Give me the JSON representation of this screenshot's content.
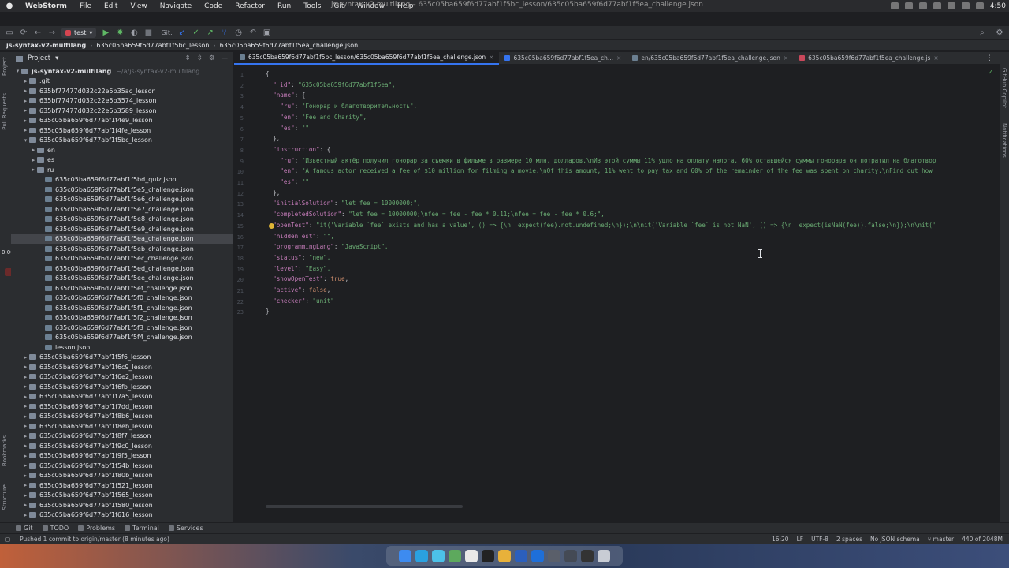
{
  "menubar": {
    "app": "WebStorm",
    "items": [
      "File",
      "Edit",
      "View",
      "Navigate",
      "Code",
      "Refactor",
      "Run",
      "Tools",
      "Git",
      "Window",
      "Help"
    ],
    "window_title": "js-syntax-v2-multilang – 635c05ba659f6d77abf1f5bc_lesson/635c05ba659f6d77abf1f5ea_challenge.json",
    "clock": "4:50"
  },
  "toolbar": {
    "run_config": "test",
    "git_label": "Git:"
  },
  "breadcrumb": [
    "js-syntax-v2-multilang",
    "635c05ba659f6d77abf1f5bc_lesson",
    "635c05ba659f6d77abf1f5ea_challenge.json"
  ],
  "left_strip": {
    "project": "Project",
    "pull_requests": "Pull Requests",
    "timer": "0:00",
    "bookmarks": "Bookmarks",
    "structure": "Structure"
  },
  "project_panel": {
    "title": "Project",
    "root": {
      "name": "js-syntax-v2-multilang",
      "path": "~/a/js-syntax-v2-multilang"
    },
    "items": [
      {
        "label": ".git",
        "indent": 1,
        "type": "folder",
        "arrow": "▸"
      },
      {
        "label": "635bf77477d032c22e5b35ac_lesson",
        "indent": 1,
        "type": "folder",
        "arrow": "▸"
      },
      {
        "label": "635bf77477d032c22e5b3574_lesson",
        "indent": 1,
        "type": "folder",
        "arrow": "▸"
      },
      {
        "label": "635bf77477d032c22e5b3589_lesson",
        "indent": 1,
        "type": "folder",
        "arrow": "▸"
      },
      {
        "label": "635c05ba659f6d77abf1f4e9_lesson",
        "indent": 1,
        "type": "folder",
        "arrow": "▸"
      },
      {
        "label": "635c05ba659f6d77abf1f4fe_lesson",
        "indent": 1,
        "type": "folder",
        "arrow": "▸"
      },
      {
        "label": "635c05ba659f6d77abf1f5bc_lesson",
        "indent": 1,
        "type": "folder",
        "arrow": "▾"
      },
      {
        "label": "en",
        "indent": 2,
        "type": "folder",
        "arrow": "▸"
      },
      {
        "label": "es",
        "indent": 2,
        "type": "folder",
        "arrow": "▸"
      },
      {
        "label": "ru",
        "indent": 2,
        "type": "folder",
        "arrow": "▸"
      },
      {
        "label": "635c05ba659f6d77abf1f5bd_quiz.json",
        "indent": 3,
        "type": "file",
        "arrow": ""
      },
      {
        "label": "635c05ba659f6d77abf1f5e5_challenge.json",
        "indent": 3,
        "type": "file",
        "arrow": ""
      },
      {
        "label": "635c05ba659f6d77abf1f5e6_challenge.json",
        "indent": 3,
        "type": "file",
        "arrow": ""
      },
      {
        "label": "635c05ba659f6d77abf1f5e7_challenge.json",
        "indent": 3,
        "type": "file",
        "arrow": ""
      },
      {
        "label": "635c05ba659f6d77abf1f5e8_challenge.json",
        "indent": 3,
        "type": "file",
        "arrow": ""
      },
      {
        "label": "635c05ba659f6d77abf1f5e9_challenge.json",
        "indent": 3,
        "type": "file",
        "arrow": ""
      },
      {
        "label": "635c05ba659f6d77abf1f5ea_challenge.json",
        "indent": 3,
        "type": "file",
        "arrow": "",
        "selected": true
      },
      {
        "label": "635c05ba659f6d77abf1f5eb_challenge.json",
        "indent": 3,
        "type": "file",
        "arrow": ""
      },
      {
        "label": "635c05ba659f6d77abf1f5ec_challenge.json",
        "indent": 3,
        "type": "file",
        "arrow": ""
      },
      {
        "label": "635c05ba659f6d77abf1f5ed_challenge.json",
        "indent": 3,
        "type": "file",
        "arrow": ""
      },
      {
        "label": "635c05ba659f6d77abf1f5ee_challenge.json",
        "indent": 3,
        "type": "file",
        "arrow": ""
      },
      {
        "label": "635c05ba659f6d77abf1f5ef_challenge.json",
        "indent": 3,
        "type": "file",
        "arrow": ""
      },
      {
        "label": "635c05ba659f6d77abf1f5f0_challenge.json",
        "indent": 3,
        "type": "file",
        "arrow": ""
      },
      {
        "label": "635c05ba659f6d77abf1f5f1_challenge.json",
        "indent": 3,
        "type": "file",
        "arrow": ""
      },
      {
        "label": "635c05ba659f6d77abf1f5f2_challenge.json",
        "indent": 3,
        "type": "file",
        "arrow": ""
      },
      {
        "label": "635c05ba659f6d77abf1f5f3_challenge.json",
        "indent": 3,
        "type": "file",
        "arrow": ""
      },
      {
        "label": "635c05ba659f6d77abf1f5f4_challenge.json",
        "indent": 3,
        "type": "file",
        "arrow": ""
      },
      {
        "label": "lesson.json",
        "indent": 3,
        "type": "file",
        "arrow": ""
      },
      {
        "label": "635c05ba659f6d77abf1f5f6_lesson",
        "indent": 1,
        "type": "folder",
        "arrow": "▸"
      },
      {
        "label": "635c05ba659f6d77abf1f6c9_lesson",
        "indent": 1,
        "type": "folder",
        "arrow": "▸"
      },
      {
        "label": "635c05ba659f6d77abf1f6e2_lesson",
        "indent": 1,
        "type": "folder",
        "arrow": "▸"
      },
      {
        "label": "635c05ba659f6d77abf1f6fb_lesson",
        "indent": 1,
        "type": "folder",
        "arrow": "▸"
      },
      {
        "label": "635c05ba659f6d77abf1f7a5_lesson",
        "indent": 1,
        "type": "folder",
        "arrow": "▸"
      },
      {
        "label": "635c05ba659f6d77abf1f7dd_lesson",
        "indent": 1,
        "type": "folder",
        "arrow": "▸"
      },
      {
        "label": "635c05ba659f6d77abf1f8b6_lesson",
        "indent": 1,
        "type": "folder",
        "arrow": "▸"
      },
      {
        "label": "635c05ba659f6d77abf1f8eb_lesson",
        "indent": 1,
        "type": "folder",
        "arrow": "▸"
      },
      {
        "label": "635c05ba659f6d77abf1f8f7_lesson",
        "indent": 1,
        "type": "folder",
        "arrow": "▸"
      },
      {
        "label": "635c05ba659f6d77abf1f9c0_lesson",
        "indent": 1,
        "type": "folder",
        "arrow": "▸"
      },
      {
        "label": "635c05ba659f6d77abf1f9f5_lesson",
        "indent": 1,
        "type": "folder",
        "arrow": "▸"
      },
      {
        "label": "635c05ba659f6d77abf1f54b_lesson",
        "indent": 1,
        "type": "folder",
        "arrow": "▸"
      },
      {
        "label": "635c05ba659f6d77abf1f80b_lesson",
        "indent": 1,
        "type": "folder",
        "arrow": "▸"
      },
      {
        "label": "635c05ba659f6d77abf1f521_lesson",
        "indent": 1,
        "type": "folder",
        "arrow": "▸"
      },
      {
        "label": "635c05ba659f6d77abf1f565_lesson",
        "indent": 1,
        "type": "folder",
        "arrow": "▸"
      },
      {
        "label": "635c05ba659f6d77abf1f580_lesson",
        "indent": 1,
        "type": "folder",
        "arrow": "▸"
      },
      {
        "label": "635c05ba659f6d77abf1f616_lesson",
        "indent": 1,
        "type": "folder",
        "arrow": "▸"
      }
    ]
  },
  "editor": {
    "tabs": [
      {
        "label": "635c05ba659f6d77abf1f5bc_lesson/635c05ba659f6d77abf1f5ea_challenge.json",
        "icon": "json",
        "active": true
      },
      {
        "label": "635c05ba659f6d77abf1f5ea_ch...",
        "icon": "ws",
        "active": false
      },
      {
        "label": "en/635c05ba659f6d77abf1f5ea_challenge.json",
        "icon": "json",
        "active": false
      },
      {
        "label": "635c05ba659f6d77abf1f5ea_challenge.js",
        "icon": "js",
        "active": false
      }
    ],
    "lines": [
      "{",
      "  \"_id\": \"635c05ba659f6d77abf1f5ea\",",
      "  \"name\": {",
      "    \"ru\": \"Гонорар и благотворительность\",",
      "    \"en\": \"Fee and Charity\",",
      "    \"es\": \"\"",
      "  },",
      "  \"instruction\": {",
      "    \"ru\": \"Известный актёр получил гонорар за съемки в фильме в размере 10 млн. долларов.\\nИз этой суммы 11% ушло на оплату налога, 60% оставшейся суммы гонорара он потратил на благотвор",
      "    \"en\": \"A famous actor received a fee of $10 million for filming a movie.\\nOf this amount, 11% went to pay tax and 60% of the remainder of the fee was spent on charity.\\nFind out how",
      "    \"es\": \"\"",
      "  },",
      "  \"initialSolution\": \"let fee = 10000000;\",",
      "  \"completedSolution\": \"let fee = 10000000;\\nfee = fee - fee * 0.11;\\nfee = fee - fee * 0.6;\",",
      "  \"openTest\": \"it('Variable `fee` exists and has a value', () => {\\n  expect(fee).not.undefined;\\n});\\n\\nit('Variable `fee` is not NaN', () => {\\n  expect(isNaN(fee)).false;\\n});\\n\\nit('",
      "  \"hiddenTest\": \"\",",
      "  \"programmingLang\": \"JavaScript\",",
      "  \"status\": \"new\",",
      "  \"level\": \"Easy\",",
      "  \"showOpenTest\": true,",
      "  \"active\": false,",
      "  \"checker\": \"unit\"",
      "}"
    ]
  },
  "right_strip": {
    "copilot": "GitHub Copilot",
    "notifications": "Notifications"
  },
  "bottom_tabs": [
    "Git",
    "TODO",
    "Problems",
    "Terminal",
    "Services"
  ],
  "statusbar": {
    "message": "Pushed 1 commit to origin/master (8 minutes ago)",
    "position": "16:20",
    "line_sep": "LF",
    "encoding": "UTF-8",
    "indent": "2 spaces",
    "schema": "No JSON schema",
    "branch": "master",
    "memory": "440 of 2048M"
  },
  "colors": {
    "accent": "#3574f0",
    "json_key": "#c77dbb",
    "json_string": "#6aab73",
    "json_keyword": "#cf8e6d"
  }
}
